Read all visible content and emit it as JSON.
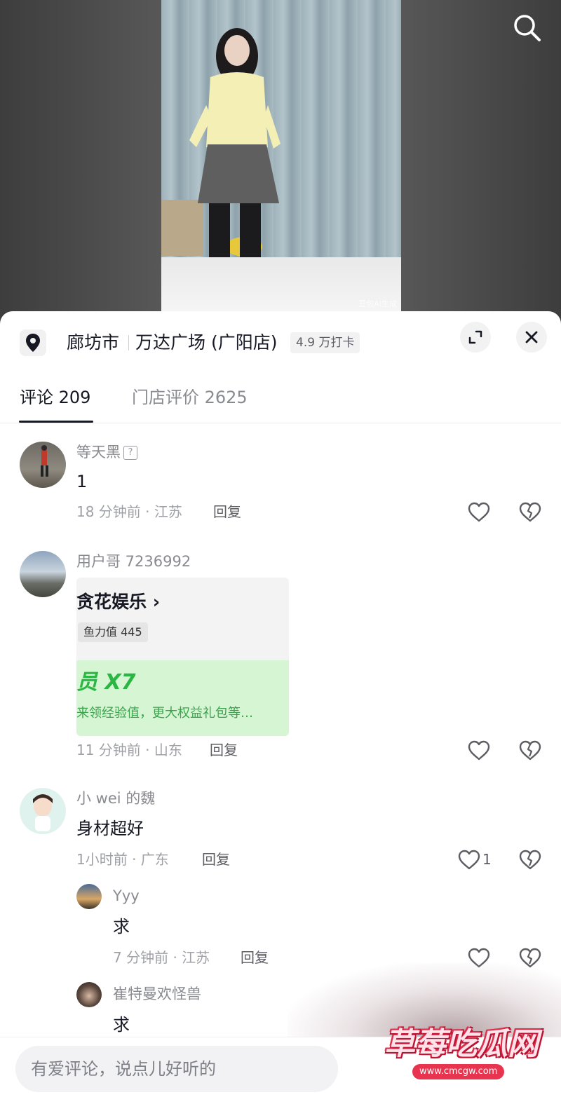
{
  "location": {
    "city": "廊坊市",
    "shop": "万达广场 (广阳店)",
    "checkins": "4.9 万打卡"
  },
  "video": {
    "watermark": "豆包AI生成"
  },
  "tabs": [
    {
      "label": "评论 209"
    },
    {
      "label": "门店评价 2625"
    }
  ],
  "comments": [
    {
      "user": "等天黑",
      "text": "1",
      "meta": "18 分钟前 · 江苏",
      "reply": "回复"
    },
    {
      "user": "用户哥 7236992",
      "card": {
        "title": "贪花娱乐 ›",
        "chip": "鱼力值 445",
        "big": "员 X7",
        "desc": "来领经验值，更大权益礼包等…"
      },
      "meta": "11 分钟前 · 山东",
      "reply": "回复"
    },
    {
      "user": "小 wei 的魏",
      "text": "身材超好",
      "meta": "1小时前 · 广东",
      "reply": "回复",
      "likes": "1"
    }
  ],
  "replies": [
    {
      "user": "Yyy",
      "text": "求",
      "meta": "7 分钟前 · 江苏",
      "reply": "回复"
    },
    {
      "user": "崔特曼欢怪兽",
      "text": "求"
    }
  ],
  "input": {
    "placeholder": "有爱评论，说点儿好听的"
  },
  "site_watermark": {
    "title": "草莓吃瓜网",
    "url": "www.cmcgw.com"
  },
  "colors": {
    "primary_text": "#161823",
    "secondary_text": "#8a8b91",
    "card_green": "#29b642"
  },
  "icons": [
    "search-icon",
    "location-pin-icon",
    "expand-icon",
    "close-icon",
    "heart-icon",
    "broken-heart-icon"
  ]
}
